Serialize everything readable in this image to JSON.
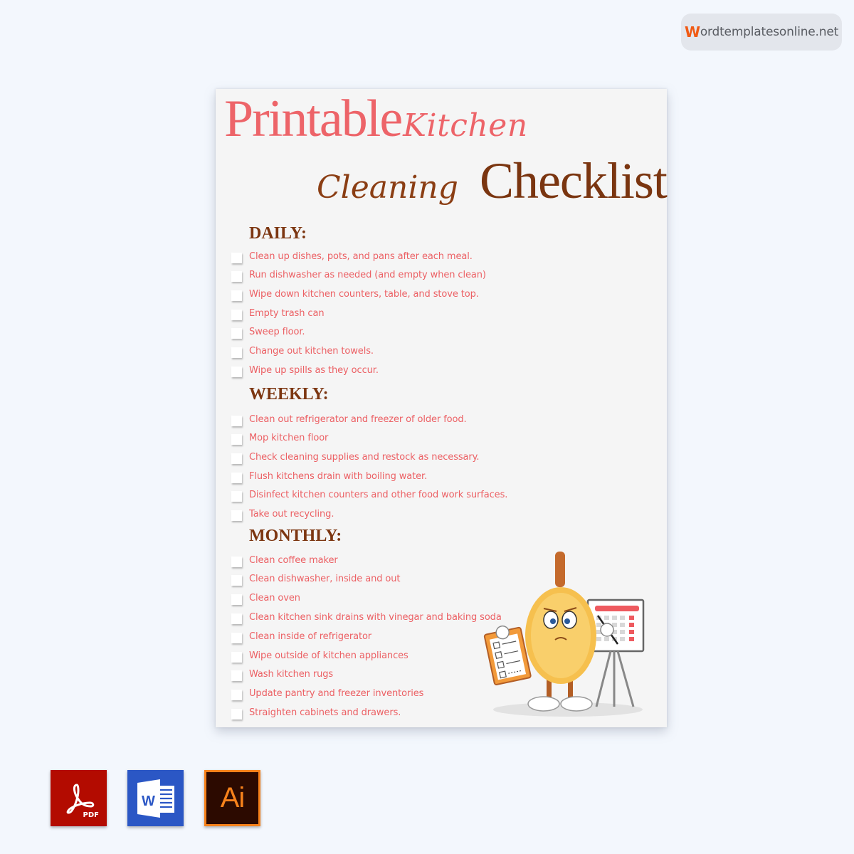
{
  "brand": {
    "first_letter": "W",
    "rest": "ordtemplatesonline.net",
    "accent_color": "#f05a14"
  },
  "document": {
    "title": {
      "word1": "Printable",
      "word2": "Kitchen",
      "word3": "Cleaning",
      "word4": "Checklist"
    },
    "colors": {
      "title_pink": "#ed6469",
      "heading_brown": "#7c3611",
      "item_text": "#ec6064",
      "paper": "#f5f5f5"
    },
    "sections": [
      {
        "heading": "DAILY:",
        "items": [
          "Clean up dishes, pots, and pans after each meal.",
          "Run dishwasher as needed (and empty when clean)",
          "Wipe down kitchen counters, table, and stove top.",
          "Empty trash can",
          "Sweep floor.",
          "Change out kitchen towels.",
          "Wipe up spills as they occur."
        ]
      },
      {
        "heading": "WEEKLY:",
        "items": [
          "Clean out refrigerator and freezer of older food.",
          "Mop kitchen floor",
          "Check cleaning supplies and restock as necessary.",
          "Flush kitchens drain with boiling water.",
          "Disinfect kitchen counters and other food work surfaces.",
          "Take out recycling."
        ]
      },
      {
        "heading": "MONTHLY:",
        "items": [
          "Clean coffee maker",
          "Clean dishwasher, inside and out",
          "Clean oven",
          "Clean kitchen sink drains with vinegar and baking soda",
          "Clean inside of refrigerator",
          "Wipe outside of kitchen appliances",
          "Wash kitchen rugs",
          "Update pantry and freezer inventories",
          "Straighten cabinets and drawers."
        ]
      }
    ],
    "illustration": "duster-mascot-with-clipboard-and-calendar"
  },
  "formats": [
    {
      "name": "pdf",
      "label": "PDF",
      "icon": "acrobat-icon",
      "color": "#b30b00"
    },
    {
      "name": "word",
      "label": "W",
      "icon": "word-icon",
      "color": "#2b57c5"
    },
    {
      "name": "illustrator",
      "label": "Ai",
      "icon": "illustrator-icon",
      "color": "#f7821b"
    }
  ]
}
